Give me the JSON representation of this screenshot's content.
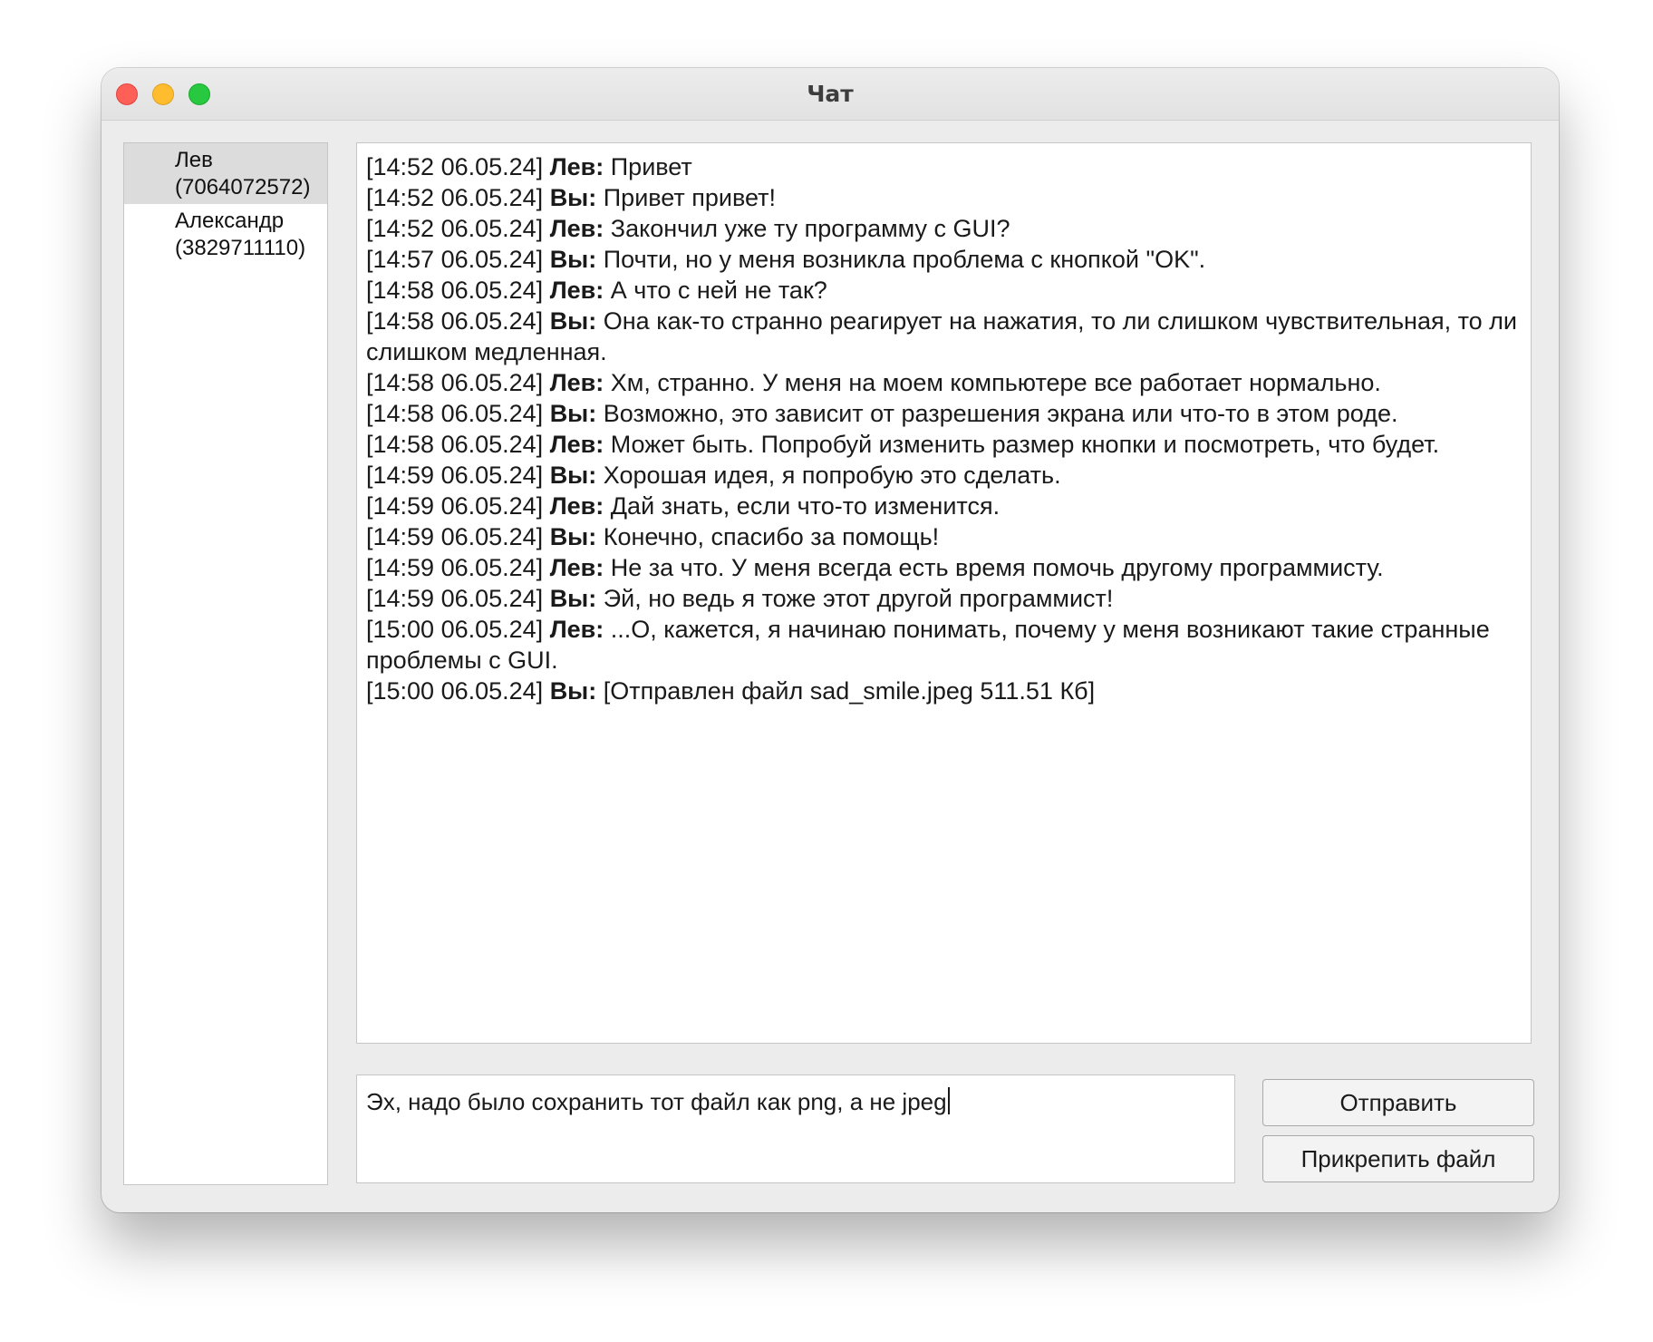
{
  "window": {
    "title": "Чат"
  },
  "contacts": [
    {
      "name": "Лев",
      "id": "(7064072572)",
      "selected": true
    },
    {
      "name": "Александр",
      "id": "(3829711110)",
      "selected": false
    }
  ],
  "messages": [
    {
      "time": "[14:52 06.05.24]",
      "sender": "Лев:",
      "text": "Привет"
    },
    {
      "time": "[14:52 06.05.24]",
      "sender": "Вы:",
      "text": "Привет привет!"
    },
    {
      "time": "[14:52 06.05.24]",
      "sender": "Лев:",
      "text": "Закончил уже ту программу с GUI?"
    },
    {
      "time": "[14:57 06.05.24]",
      "sender": "Вы:",
      "text": "Почти, но у меня возникла проблема с кнопкой \"OK\"."
    },
    {
      "time": "[14:58 06.05.24]",
      "sender": "Лев:",
      "text": "А что с ней не так?"
    },
    {
      "time": "[14:58 06.05.24]",
      "sender": "Вы:",
      "text": "Она как-то странно реагирует на нажатия, то ли слишком чувствительная, то ли слишком медленная."
    },
    {
      "time": "[14:58 06.05.24]",
      "sender": "Лев:",
      "text": "Хм, странно. У меня на моем компьютере все работает нормально."
    },
    {
      "time": "[14:58 06.05.24]",
      "sender": "Вы:",
      "text": "Возможно, это зависит от разрешения экрана или что-то в этом роде."
    },
    {
      "time": "[14:58 06.05.24]",
      "sender": "Лев:",
      "text": "Может быть. Попробуй изменить размер кнопки и посмотреть, что будет."
    },
    {
      "time": "[14:59 06.05.24]",
      "sender": "Вы:",
      "text": "Хорошая идея, я попробую это сделать."
    },
    {
      "time": "[14:59 06.05.24]",
      "sender": "Лев:",
      "text": "Дай знать, если что-то изменится."
    },
    {
      "time": "[14:59 06.05.24]",
      "sender": "Вы:",
      "text": "Конечно, спасибо за помощь!"
    },
    {
      "time": "[14:59 06.05.24]",
      "sender": "Лев:",
      "text": "Не за что. У меня всегда есть время помочь другому программисту."
    },
    {
      "time": "[14:59 06.05.24]",
      "sender": "Вы:",
      "text": "Эй, но ведь я тоже этот другой программист!"
    },
    {
      "time": "[15:00 06.05.24]",
      "sender": "Лев:",
      "text": "...О, кажется, я начинаю понимать, почему у меня возникают такие странные проблемы с GUI."
    },
    {
      "time": "[15:00 06.05.24]",
      "sender": "Вы:",
      "text": "[Отправлен файл sad_smile.jpeg 511.51 Кб]"
    }
  ],
  "composer": {
    "value": "Эх, надо было сохранить тот файл как png, а не jpeg"
  },
  "buttons": {
    "send": "Отправить",
    "attach": "Прикрепить файл"
  }
}
